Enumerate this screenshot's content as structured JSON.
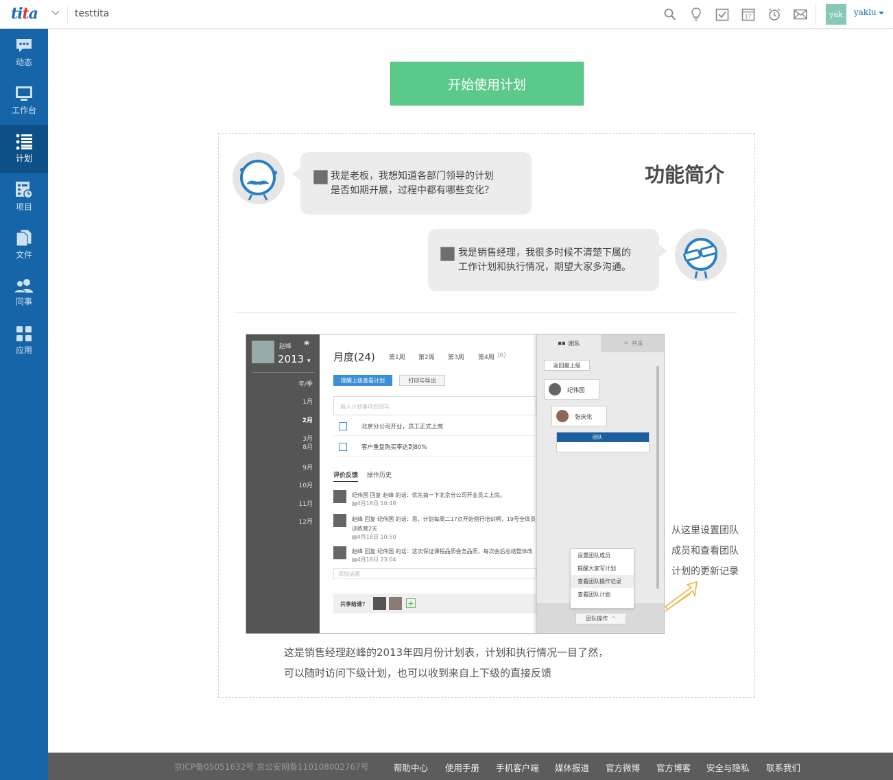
{
  "app": {
    "logo": "tita",
    "org_name": "testtita"
  },
  "topbar": {
    "icons": [
      "search-icon",
      "lightbulb-icon",
      "task-check-icon",
      "calendar-icon",
      "alarm-icon",
      "mail-icon"
    ],
    "calendar_day": "17",
    "avatar_text": "yak",
    "username": "yaklu"
  },
  "sidebar": {
    "items": [
      {
        "label": "动态",
        "icon": "chat-bubble-icon",
        "active": false
      },
      {
        "label": "工作台",
        "icon": "monitor-icon",
        "active": false
      },
      {
        "label": "计划",
        "icon": "list-icon",
        "active": true
      },
      {
        "label": "项目",
        "icon": "project-chart-icon",
        "active": false
      },
      {
        "label": "文件",
        "icon": "files-icon",
        "active": false
      },
      {
        "label": "同事",
        "icon": "people-icon",
        "active": false
      },
      {
        "label": "应用",
        "icon": "apps-grid-icon",
        "active": false
      }
    ]
  },
  "main": {
    "start_button": "开始使用计划",
    "intro_title": "功能简介",
    "dialog": [
      {
        "line1": "我是老板，我想知道各部门领导的计划",
        "line2": "是否如期开展，过程中都有哪些变化？"
      },
      {
        "line1": "我是销售经理，我很多时候不清楚下属的",
        "line2": "工作计划和执行情况，期望大家多沟通。"
      }
    ],
    "preview": {
      "user_name": "赵峰",
      "year": "2013",
      "year_caret": "▾",
      "period_label": "年/季",
      "months": [
        "1月",
        "2月",
        "3月",
        "8月",
        "9月",
        "10月",
        "11月",
        "12月"
      ],
      "title": "月度(24)",
      "weeks": [
        "第1周",
        "第2周",
        "第3周",
        "第4周"
      ],
      "week4_count": "(6)",
      "btn_supervisor": "提醒上级查看计划",
      "btn_print": "打印与导出",
      "input_placeholder": "输入计划事项后回车",
      "tasks": [
        "北京分公司开业，员工正式上岗",
        "客户重复购买率达到80%"
      ],
      "tab_feedback": "评价反馈",
      "tab_history": "操作历史",
      "comments": [
        {
          "text": "纪伟国 回复 赵峰 的话：优先搞一下北京分公司开业员工上岗。",
          "time": "4月18日 10:48"
        },
        {
          "text": "赵峰 回复 纪伟国 的话：恩，计划每周二17点开始例行培训啊，19号全体员",
          "text2": "训练营2天",
          "time": "4月18日 10:50"
        },
        {
          "text": "赵峰 回复 纪伟国 的话：这次保证课程品质会务品质，每次会后总结整体改",
          "time": "4月18日 23:04"
        }
      ],
      "add_comment": "添加话题",
      "share_label": "共享给谁？",
      "share_plus": "+",
      "tab_team": "团队",
      "tab_share": "共享",
      "back_top": "返回最上级",
      "node1": "纪伟国",
      "node2": "张庆化",
      "team_bar": "团队",
      "menu": [
        "设置团队成员",
        "提醒大家写计划",
        "查看团队操作记录",
        "查看团队计划"
      ],
      "team_op": "团队操作"
    },
    "side_note": [
      "从这里设置团队",
      "成员和查看团队",
      "计划的更新记录"
    ],
    "caption": [
      "这是销售经理赵峰的2013年四月份计划表，计划和执行情况一目了然，",
      "可以随时访问下级计划，也可以收到来自上下级的直接反馈"
    ]
  },
  "footer": {
    "icp": "京ICP备05051632号  京公安网备110108002767号",
    "links": [
      "帮助中心",
      "使用手册",
      "手机客户端",
      "媒体报道",
      "官方微博",
      "官方博客",
      "安全与隐私",
      "联系我们"
    ]
  },
  "colors": {
    "sidebar": "#1565a8",
    "sidebar_active": "#0d4f87",
    "accent_green": "#5bc98a",
    "footer": "#5c5c5c",
    "link_blue": "#1a6db5"
  }
}
